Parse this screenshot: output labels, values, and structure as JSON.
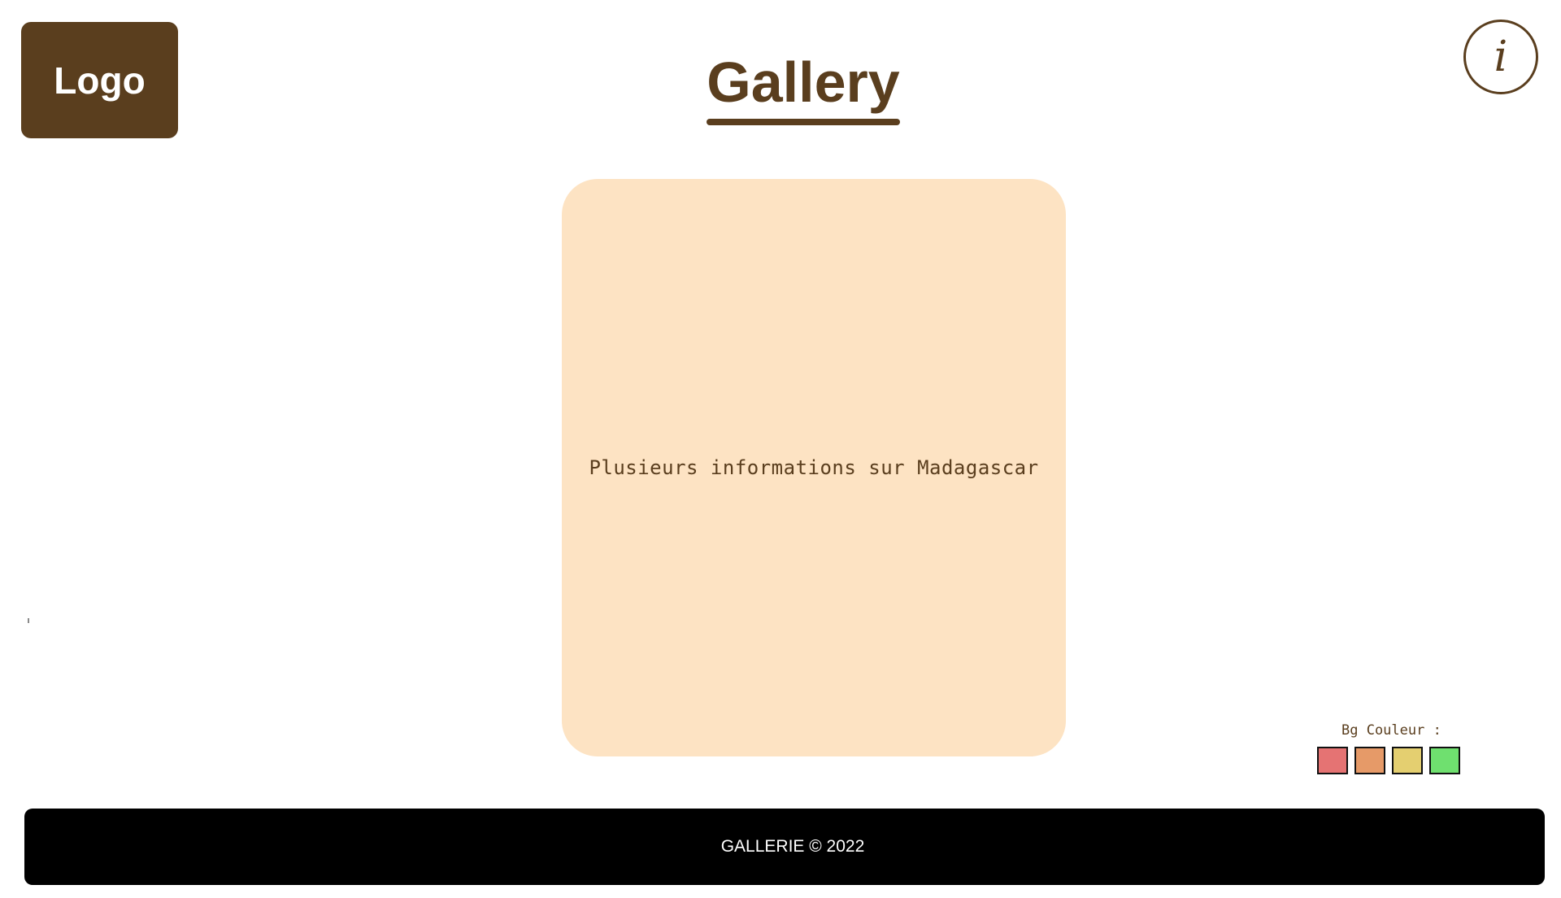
{
  "header": {
    "logo_label": "Logo",
    "title": "Gallery",
    "info_label": "i"
  },
  "main": {
    "card_text": "Plusieurs informations sur Madagascar"
  },
  "bg_picker": {
    "label": "Bg Couleur :",
    "swatches": [
      {
        "color": "#e57373"
      },
      {
        "color": "#e69a68"
      },
      {
        "color": "#e4cf70"
      },
      {
        "color": "#6fe06f"
      }
    ]
  },
  "footer": {
    "text": "GALLERIE © 2022"
  },
  "colors": {
    "brand": "#5a3e1e",
    "card_bg": "#fde3c3",
    "footer_bg": "#000000"
  }
}
